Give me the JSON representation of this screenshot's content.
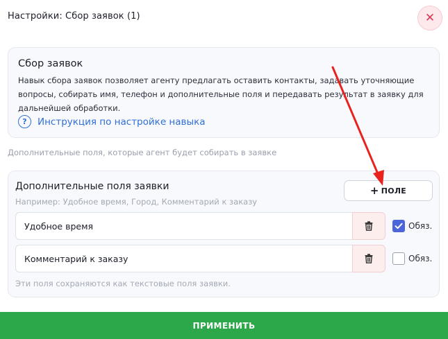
{
  "header": {
    "title": "Настройки: Сбор заявок (1)",
    "close_icon": "✕"
  },
  "skill": {
    "title": "Сбор заявок",
    "description": "Навык сбора заявок позволяет агенту предлагать оставить контакты, задавать уточняющие вопросы, собирать имя, телефон и дополнительные поля и передавать результат в заявку для дальнейшей обработки.",
    "guide_icon": "?",
    "guide_link": "Инструкция по настройке навыка"
  },
  "hint_top": "Дополнительные поля, которые агент будет собирать в заявке",
  "fields": {
    "title": "Дополнительные поля заявки",
    "example": "Например: Удобное время, Город, Комментарий к заказу",
    "add_plus": "+",
    "add_label": "ПОЛЕ",
    "required_label": "Обяз.",
    "items": [
      {
        "value": "Удобное время",
        "required": true
      },
      {
        "value": "Комментарий к заказу",
        "required": false
      }
    ],
    "note": "Эти поля сохраняются как текстовые поля заявки."
  },
  "apply_label": "ПРИМЕНИТЬ",
  "colors": {
    "accent": "#4a66d8",
    "apply": "#2ca84a",
    "danger": "#d23a55",
    "arrow": "#e8231f"
  }
}
